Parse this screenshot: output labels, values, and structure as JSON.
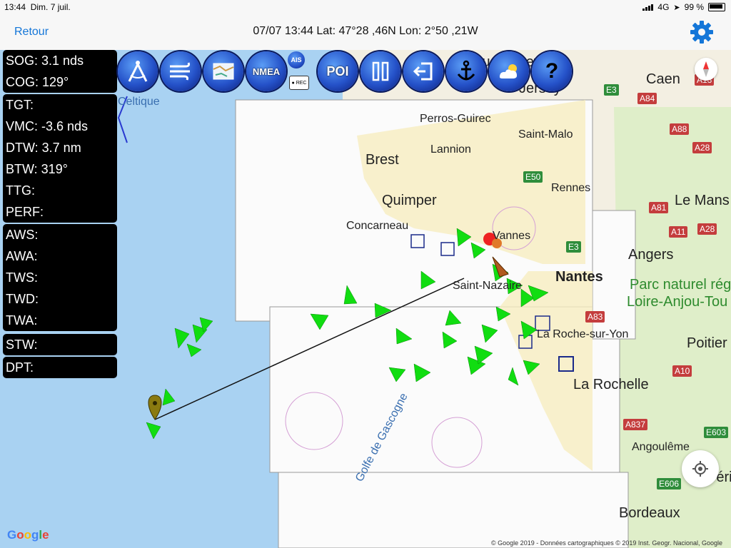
{
  "status": {
    "time": "13:44",
    "date": "Dim. 7 juil.",
    "network": "4G",
    "battery": "99 %"
  },
  "nav": {
    "back_label": "Retour",
    "title": "07/07 13:44  Lat: 47°28 ,46N Lon: 2°50 ,21W"
  },
  "panels": {
    "nav1": [
      {
        "label": "SOG: 3.1 nds"
      },
      {
        "label": "COG: 129°"
      }
    ],
    "nav2": [
      {
        "label": "TGT:"
      },
      {
        "label": "VMC: -3.6 nds"
      },
      {
        "label": "DTW: 3.7 nm"
      },
      {
        "label": "BTW: 319°"
      },
      {
        "label": "TTG:"
      },
      {
        "label": "PERF:"
      }
    ],
    "wind": [
      {
        "label": "AWS:"
      },
      {
        "label": "AWA:"
      },
      {
        "label": "TWS:"
      },
      {
        "label": "TWD:"
      },
      {
        "label": "TWA:"
      }
    ],
    "stw": [
      {
        "label": "STW:"
      }
    ],
    "dpt": [
      {
        "label": "DPT:"
      }
    ]
  },
  "toolbar": {
    "nmea_label": "NMEA",
    "ais_label": "AIS",
    "rec_label": "● REC",
    "poi_label": "POI",
    "help_label": "?"
  },
  "map": {
    "labels": {
      "celtique": "Celtique",
      "guernesey": "Guernesey",
      "jersey": "Jersey",
      "caen": "Caen",
      "perros": "Perros-Guirec",
      "saintmalo": "Saint-Malo",
      "lannion": "Lannion",
      "brest": "Brest",
      "rennes": "Rennes",
      "quimper": "Quimper",
      "lemans": "Le Mans",
      "concarneau": "Concarneau",
      "vannes": "Vannes",
      "angers": "Angers",
      "nantes": "Nantes",
      "parc1": "Parc naturel régi",
      "parc2": "Loire-Anjou-Tou",
      "saintnazaire": "Saint-Nazaire",
      "larochesuryon": "La Roche-sur-Yon",
      "poitiers": "Poitier",
      "larochelle": "La Rochelle",
      "golfe": "Golfe de Gascogne",
      "angouleme": "Angoulême",
      "perigueux": "Péri",
      "bordeaux": "Bordeaux"
    },
    "roads": {
      "e3a": "E3",
      "a84": "A84",
      "a13": "A13",
      "a88": "A88",
      "a28a": "A28",
      "e50": "E50",
      "a81": "A81",
      "a11": "A11",
      "a28b": "A28",
      "e3b": "E3",
      "a83": "A83",
      "a10": "A10",
      "a837": "A837",
      "e603": "E603",
      "e606": "E606"
    },
    "google": "Google",
    "copyright": "© Google 2019 - Données cartographiques © 2019 Inst. Geogr. Nacional, Google"
  },
  "colors": {
    "accent": "#1476d8",
    "ais_target": "#11dd11",
    "water": "#a9d2f2"
  },
  "icons": {
    "settings": "gear-icon",
    "locate": "crosshair-icon",
    "compass": "compass-arrow-icon"
  }
}
